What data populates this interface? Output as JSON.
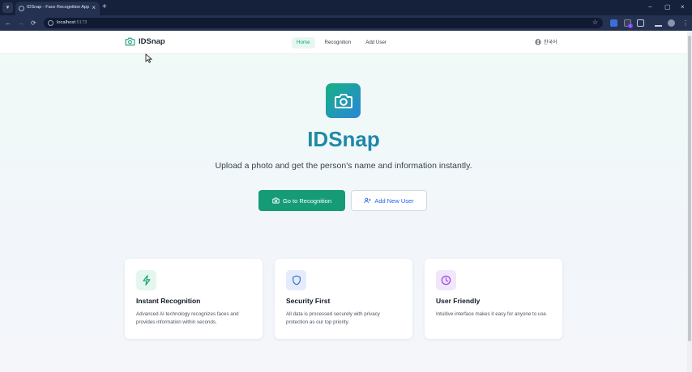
{
  "browser": {
    "tab_title": "IDSnap - Face Recognition App",
    "tab_close": "×",
    "new_tab": "+",
    "menu_glyph": "▾",
    "url_host": "localhost",
    "url_port": ":5173",
    "nav_back": "←",
    "nav_forward": "→",
    "nav_reload": "⟳",
    "star": "☆",
    "win_min": "−",
    "win_max": "▢",
    "win_close": "×",
    "kebab": "⋮",
    "ext_badge": "1",
    "icons": [
      "translate-icon",
      "extension-icon",
      "puzzle-icon",
      "download-icon",
      "profile-avatar"
    ]
  },
  "header": {
    "logo_text": "IDSnap",
    "nav": [
      "Home",
      "Recognition",
      "Add User"
    ],
    "active_index": 0,
    "language": "한국어"
  },
  "hero": {
    "title": "IDSnap",
    "subtitle": "Upload a photo and get the person's name and information instantly.",
    "primary_button": "Go to Recognition",
    "secondary_button": "Add New User"
  },
  "features": [
    {
      "title": "Instant Recognition",
      "description": "Advanced AI technology recognizes faces and provides information within seconds.",
      "icon": "lightning-icon",
      "icon_bg": "#e3f7ee",
      "icon_color": "#15a173"
    },
    {
      "title": "Security First",
      "description": "All data is processed securely with privacy protection as our top priority.",
      "icon": "shield-icon",
      "icon_bg": "#e4ecfb",
      "icon_color": "#2f6fd6"
    },
    {
      "title": "User Friendly",
      "description": "Intuitive interface makes it easy for anyone to use.",
      "icon": "clock-icon",
      "icon_bg": "#f1e6fb",
      "icon_color": "#9d4fe0"
    }
  ],
  "colors": {
    "brand_green": "#159c77",
    "brand_blue": "#2b6fd2",
    "chrome_dark": "#15203b"
  }
}
